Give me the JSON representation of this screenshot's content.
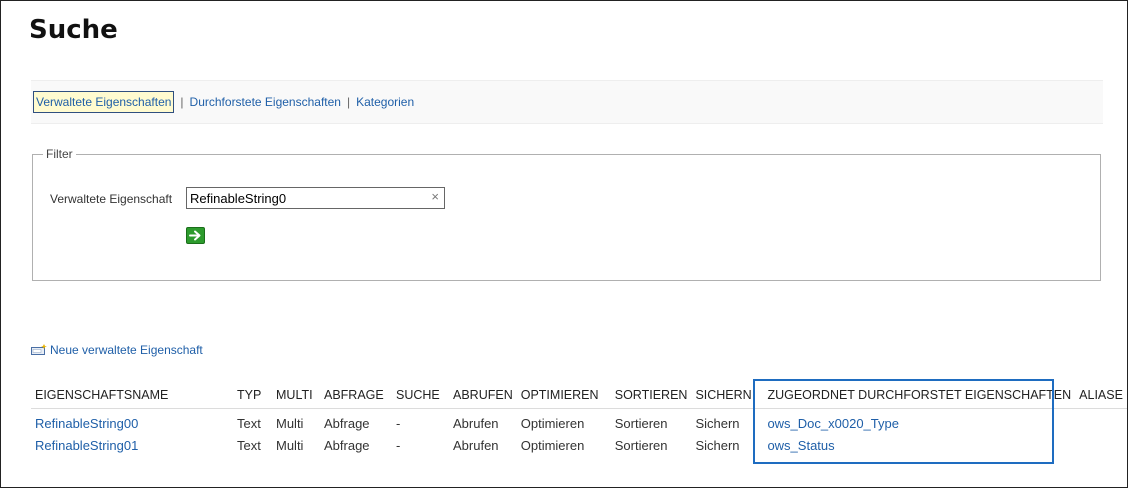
{
  "page": {
    "title": "Suche"
  },
  "subnav": {
    "items": [
      {
        "label": "Verwaltete Eigenschaften"
      },
      {
        "label": "Durchforstete Eigenschaften"
      },
      {
        "label": "Kategorien"
      }
    ],
    "separator": "|"
  },
  "filter": {
    "legend": "Filter",
    "label": "Verwaltete Eigenschaft",
    "value": "RefinableString0",
    "clear": "×"
  },
  "new_property_link": "Neue verwaltete Eigenschaft",
  "table": {
    "headers": [
      "EIGENSCHAFTSNAME",
      "TYP",
      "MULTI",
      "ABFRAGE",
      "SUCHE",
      "ABRUFEN",
      "OPTIMIEREN",
      "SORTIEREN",
      "SICHERN",
      "ZUGEORDNET DURCHFORSTET EIGENSCHAFTEN",
      "ALIASE"
    ],
    "rows": [
      {
        "name": "RefinableString00",
        "typ": "Text",
        "multi": "Multi",
        "abfrage": "Abfrage",
        "suche": "-",
        "abrufen": "Abrufen",
        "optimieren": "Optimieren",
        "sortieren": "Sortieren",
        "sichern": "Sichern",
        "mapped": "ows_Doc_x0020_Type",
        "aliase": ""
      },
      {
        "name": "RefinableString01",
        "typ": "Text",
        "multi": "Multi",
        "abfrage": "Abfrage",
        "suche": "-",
        "abrufen": "Abrufen",
        "optimieren": "Optimieren",
        "sortieren": "Sortieren",
        "sichern": "Sichern",
        "mapped": "ows_Status",
        "aliase": ""
      }
    ]
  },
  "icons": {
    "go": "arrow-right-icon",
    "new_property": "new-property-icon"
  },
  "colors": {
    "link": "#1f5fa8",
    "highlight": "#1e6cc0",
    "go_button": "#2d9b2d"
  }
}
